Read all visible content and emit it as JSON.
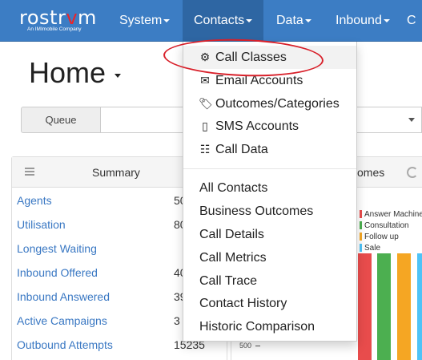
{
  "brand": {
    "name_prefix": "rostr",
    "name_v": "v",
    "name_suffix": "m",
    "tagline": "An IMImobile Company"
  },
  "nav": [
    {
      "label": "System"
    },
    {
      "label": "Contacts"
    },
    {
      "label": "Data"
    },
    {
      "label": "Inbound"
    },
    {
      "label": "C"
    }
  ],
  "page": {
    "title": "Home"
  },
  "queue": {
    "label": "Queue"
  },
  "summary": {
    "title": "Summary",
    "rows": [
      {
        "label": "Agents",
        "value": "50"
      },
      {
        "label": "Utilisation",
        "value": "80"
      },
      {
        "label": "Longest Waiting",
        "value": ""
      },
      {
        "label": "Inbound Offered",
        "value": "40"
      },
      {
        "label": "Inbound Answered",
        "value": "39"
      },
      {
        "label": "Active Campaigns",
        "value": "3"
      },
      {
        "label": "Outbound Attempts",
        "value": "15235"
      }
    ]
  },
  "outcomes": {
    "title": "comes",
    "ytick": "500",
    "legend": [
      {
        "label": "Answer Machine",
        "color": "#e84c4c"
      },
      {
        "label": "Consultation",
        "color": "#4caf50"
      },
      {
        "label": "Follow up",
        "color": "#f5a623"
      },
      {
        "label": "Sale",
        "color": "#4fc3f7"
      }
    ]
  },
  "dropdown": {
    "items": [
      {
        "label": "Call Classes",
        "icon": "gear-icon",
        "glyph": "⚙"
      },
      {
        "label": "Email Accounts",
        "icon": "envelope-icon",
        "glyph": "✉"
      },
      {
        "label": "Outcomes/Categories",
        "icon": "tags-icon",
        "glyph": "🏷"
      },
      {
        "label": "SMS Accounts",
        "icon": "mobile-icon",
        "glyph": "▯"
      },
      {
        "label": "Call Data",
        "icon": "list-table-icon",
        "glyph": "☷"
      }
    ],
    "reports": [
      {
        "label": "All Contacts"
      },
      {
        "label": "Business Outcomes"
      },
      {
        "label": "Call Details"
      },
      {
        "label": "Call Metrics"
      },
      {
        "label": "Call Trace"
      },
      {
        "label": "Contact History"
      },
      {
        "label": "Historic Comparison"
      }
    ]
  }
}
